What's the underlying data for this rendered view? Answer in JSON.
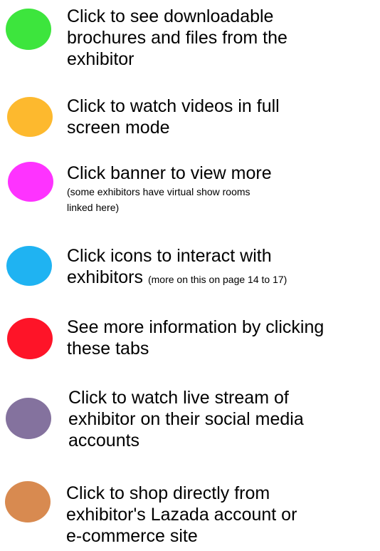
{
  "legend": [
    {
      "color": "#3de53d",
      "lines": [
        "Click to see downloadable",
        "brochures and files from the",
        "exhibitor"
      ]
    },
    {
      "color": "#fdb92e",
      "lines": [
        "Click to watch videos in full",
        "screen mode"
      ]
    },
    {
      "color": "#fe33ff",
      "lines": [
        "Click banner to view more"
      ],
      "note_lines": [
        "(some exhibitors have virtual show rooms",
        "linked here)"
      ]
    },
    {
      "color": "#1fb3f2",
      "lines": [
        "Click icons to interact with",
        "exhibitors"
      ],
      "inline_note": "(more on this on page 14 to 17)"
    },
    {
      "color": "#fe1428",
      "lines": [
        "See more information by clicking",
        "these tabs"
      ]
    },
    {
      "color": "#84729e",
      "lines": [
        "Click to watch live stream of",
        "exhibitor on their social media",
        "accounts"
      ]
    },
    {
      "color": "#d88a50",
      "lines": [
        "Click to shop directly from",
        "exhibitor's Lazada account or",
        "e-commerce site"
      ]
    }
  ]
}
